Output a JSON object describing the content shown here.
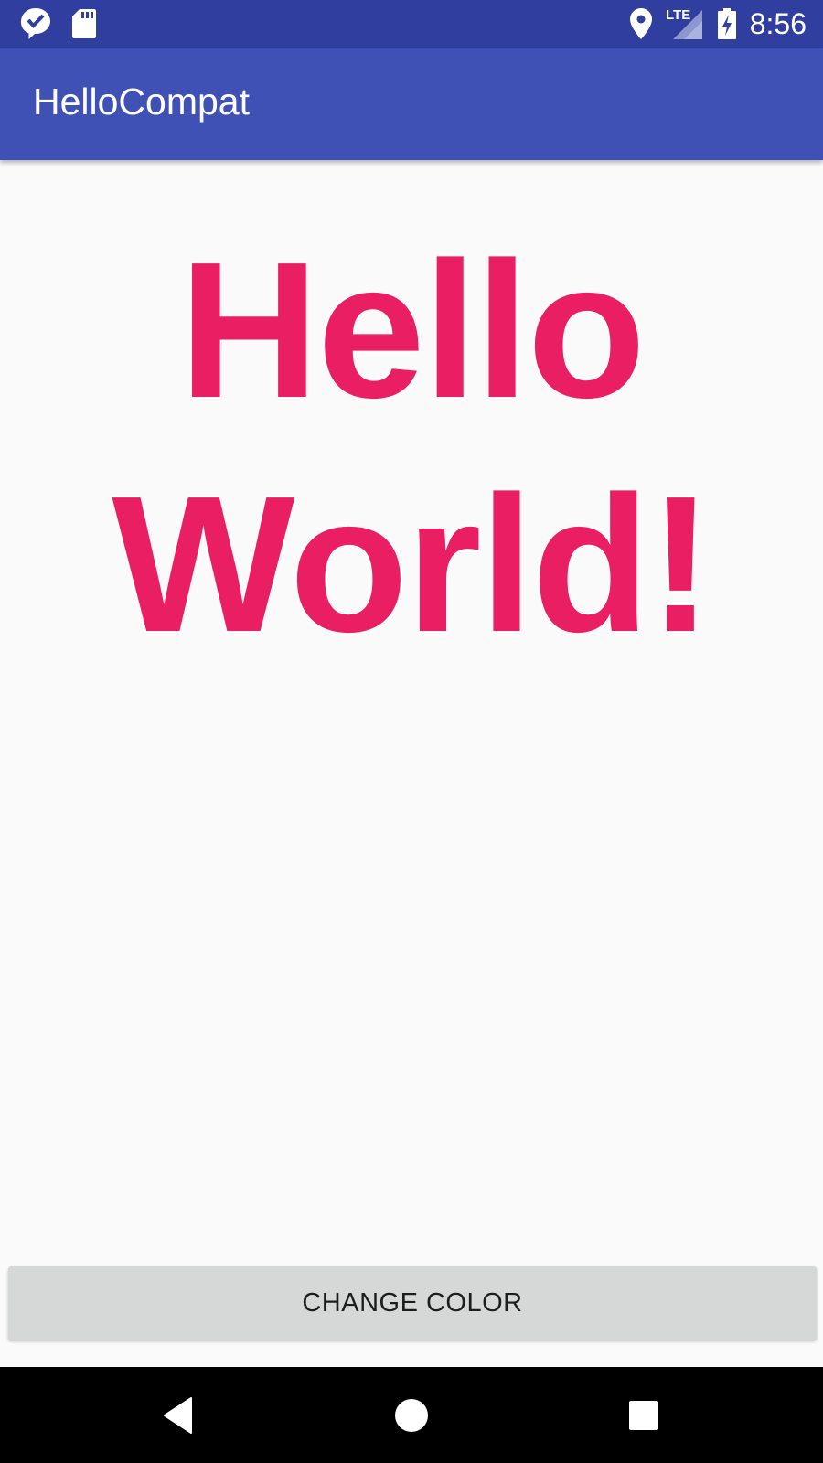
{
  "status_bar": {
    "time": "8:56",
    "network_label": "LTE",
    "icons": [
      "notification-check-icon",
      "sd-card-icon",
      "location-icon",
      "lte-signal-icon",
      "battery-charging-icon"
    ]
  },
  "app_bar": {
    "title": "HelloCompat"
  },
  "main": {
    "hello_text": "Hello World!",
    "text_color": "#e91e63"
  },
  "button": {
    "label": "CHANGE COLOR"
  },
  "nav_bar": {
    "icons": [
      "back-icon",
      "home-icon",
      "recents-icon"
    ]
  },
  "colors": {
    "status_bar": "#303f9f",
    "app_bar": "#3f51b5",
    "background": "#fafafa",
    "button": "#d6d7d7"
  }
}
